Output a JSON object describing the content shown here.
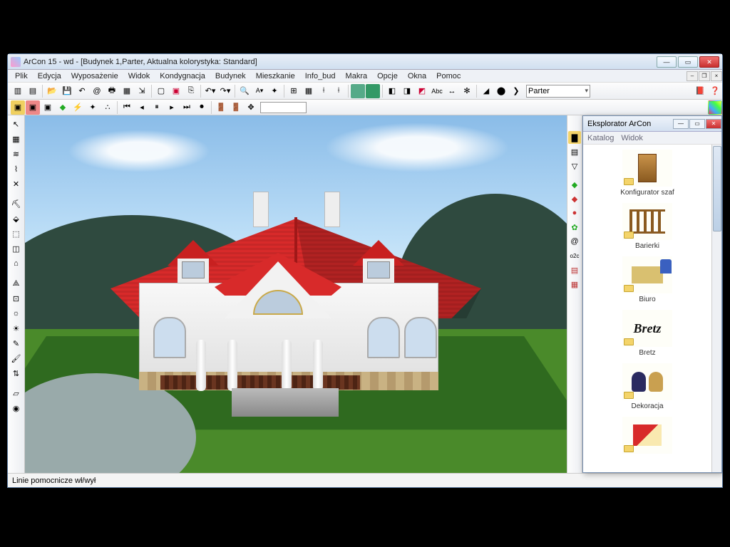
{
  "window": {
    "title": "ArCon 15 - wd - [Budynek 1,Parter, Aktualna kolorystyka: Standard]"
  },
  "menu": {
    "items": [
      "Plik",
      "Edycja",
      "Wyposażenie",
      "Widok",
      "Kondygnacja",
      "Budynek",
      "Mieszkanie",
      "Info_bud",
      "Makra",
      "Opcje",
      "Okna",
      "Pomoc"
    ]
  },
  "toolbar1": {
    "floor_selector": "Parter"
  },
  "statusbar": {
    "hint": "Linie pomocnicze wł/wył"
  },
  "explorer": {
    "title": "Eksplorator ArCon",
    "menu": [
      "Katalog",
      "Widok"
    ],
    "items": [
      {
        "label": "Konfigurator szaf"
      },
      {
        "label": "Barierki"
      },
      {
        "label": "Biuro"
      },
      {
        "label": "Bretz"
      },
      {
        "label": "Dekoracja"
      }
    ]
  },
  "colors": {
    "roof": "#d82a2a",
    "grass": "#4a8a2a",
    "hills": "#2f4a3f",
    "sky_top": "#8abce8"
  }
}
